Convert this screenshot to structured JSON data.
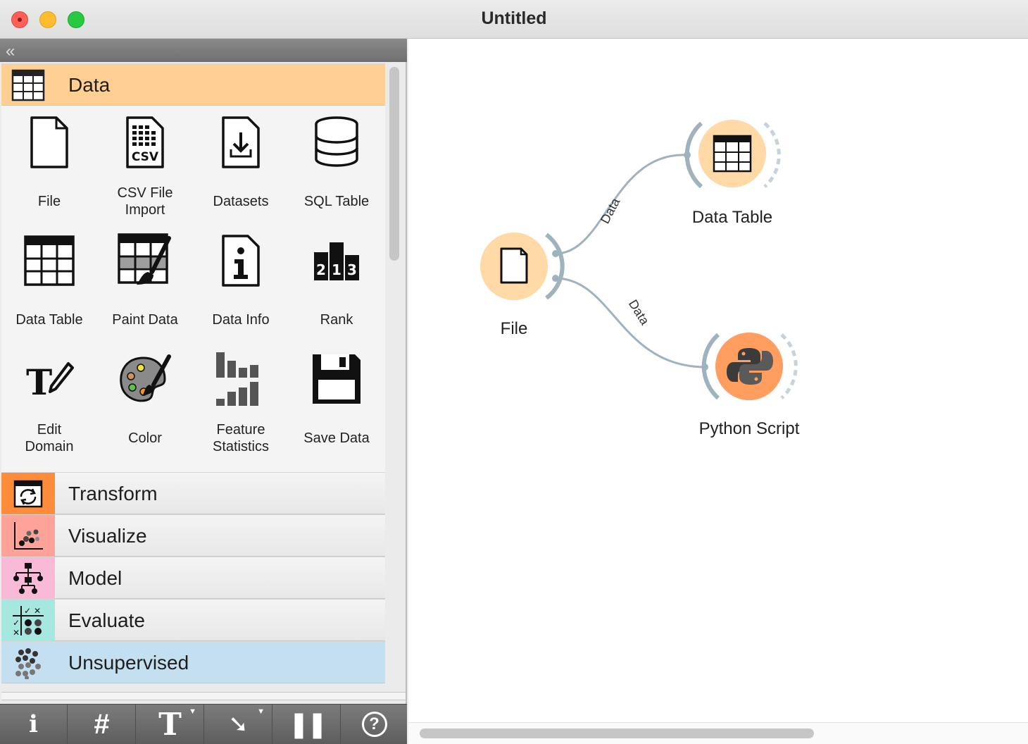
{
  "window": {
    "title": "Untitled"
  },
  "toolbox": {
    "categories": [
      {
        "label": "Data",
        "color": "#ffcf94",
        "icon": "data-table-icon"
      },
      {
        "label": "Transform",
        "color": "#ff8c3a",
        "icon": "transform-icon"
      },
      {
        "label": "Visualize",
        "color": "#ffa39a",
        "icon": "scatter-icon"
      },
      {
        "label": "Model",
        "color": "#fab9d6",
        "icon": "tree-icon"
      },
      {
        "label": "Evaluate",
        "color": "#a6e8e0",
        "icon": "evaluate-icon"
      },
      {
        "label": "Unsupervised",
        "color": "#c3dff0",
        "icon": "cluster-icon"
      }
    ],
    "widgets": [
      {
        "line1": "File",
        "line2": "",
        "icon": "file-icon"
      },
      {
        "line1": "CSV File",
        "line2": "Import",
        "icon": "csv-icon"
      },
      {
        "line1": "Datasets",
        "line2": "",
        "icon": "datasets-icon"
      },
      {
        "line1": "SQL Table",
        "line2": "",
        "icon": "database-icon"
      },
      {
        "line1": "Data Table",
        "line2": "",
        "icon": "table-icon"
      },
      {
        "line1": "Paint Data",
        "line2": "",
        "icon": "paint-icon"
      },
      {
        "line1": "Data Info",
        "line2": "",
        "icon": "info-icon"
      },
      {
        "line1": "Rank",
        "line2": "",
        "icon": "rank-icon"
      },
      {
        "line1": "Edit",
        "line2": "Domain",
        "icon": "edit-domain-icon"
      },
      {
        "line1": "Color",
        "line2": "",
        "icon": "palette-icon"
      },
      {
        "line1": "Feature",
        "line2": "Statistics",
        "icon": "bar-stats-icon"
      },
      {
        "line1": "Save Data",
        "line2": "",
        "icon": "floppy-icon"
      }
    ],
    "rank_digits": [
      "2",
      "1",
      "3"
    ],
    "csv_text": "CSV"
  },
  "bottom_toolbar": {
    "buttons": [
      {
        "name": "info",
        "icon": "info-icon",
        "glyph": "i"
      },
      {
        "name": "grid",
        "icon": "grid-icon",
        "glyph": "#"
      },
      {
        "name": "text-annotation",
        "icon": "text-icon",
        "glyph": "T"
      },
      {
        "name": "arrow-annotation",
        "icon": "arrow-icon",
        "glyph": "➘"
      },
      {
        "name": "pause",
        "icon": "pause-icon",
        "glyph": "❚❚"
      },
      {
        "name": "help",
        "icon": "help-icon",
        "glyph": "?"
      }
    ]
  },
  "canvas": {
    "nodes": [
      {
        "label": "File",
        "icon": "file-icon"
      },
      {
        "label": "Data Table",
        "icon": "table-icon"
      },
      {
        "label": "Python Script",
        "icon": "python-icon"
      }
    ],
    "links": [
      {
        "label": "Data"
      },
      {
        "label": "Data"
      }
    ]
  }
}
